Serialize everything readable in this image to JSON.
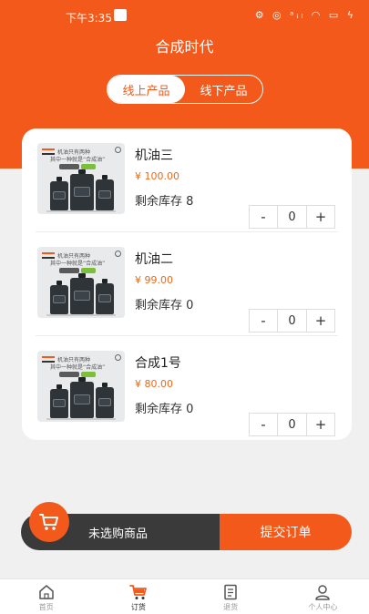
{
  "status_bar": {
    "time": "下午3:35",
    "icons": "⚙ ◎ ᵃᵢₗ ◠ ▭ ϟ"
  },
  "header": {
    "title": "合成时代"
  },
  "segment": {
    "tabs": [
      {
        "label": "线上产品",
        "active": true
      },
      {
        "label": "线下产品",
        "active": false
      }
    ]
  },
  "products": [
    {
      "name": "机油三",
      "price": "¥ 100.00",
      "stock": "剩余库存 8",
      "qty": "0"
    },
    {
      "name": "机油二",
      "price": "¥ 99.00",
      "stock": "剩余库存 0",
      "qty": "0"
    },
    {
      "name": "合成1号",
      "price": "¥ 80.00",
      "stock": "剩余库存 0",
      "qty": "0"
    }
  ],
  "stepper": {
    "minus": "-",
    "plus": "+"
  },
  "thumbnail": {
    "line1": "机油只有两种",
    "line2": "其中一种就是“合成油”"
  },
  "cart": {
    "status": "未选购商品",
    "submit": "提交订单"
  },
  "tabbar": {
    "items": [
      {
        "label": "首页",
        "icon": "home-icon"
      },
      {
        "label": "订货",
        "icon": "cart-icon",
        "active": true
      },
      {
        "label": "退货",
        "icon": "document-icon"
      },
      {
        "label": "个人中心",
        "icon": "person-icon"
      }
    ]
  },
  "colors": {
    "brand": "#f2591a",
    "price": "#e86a1a",
    "cart_dark": "#3a3a3a"
  }
}
